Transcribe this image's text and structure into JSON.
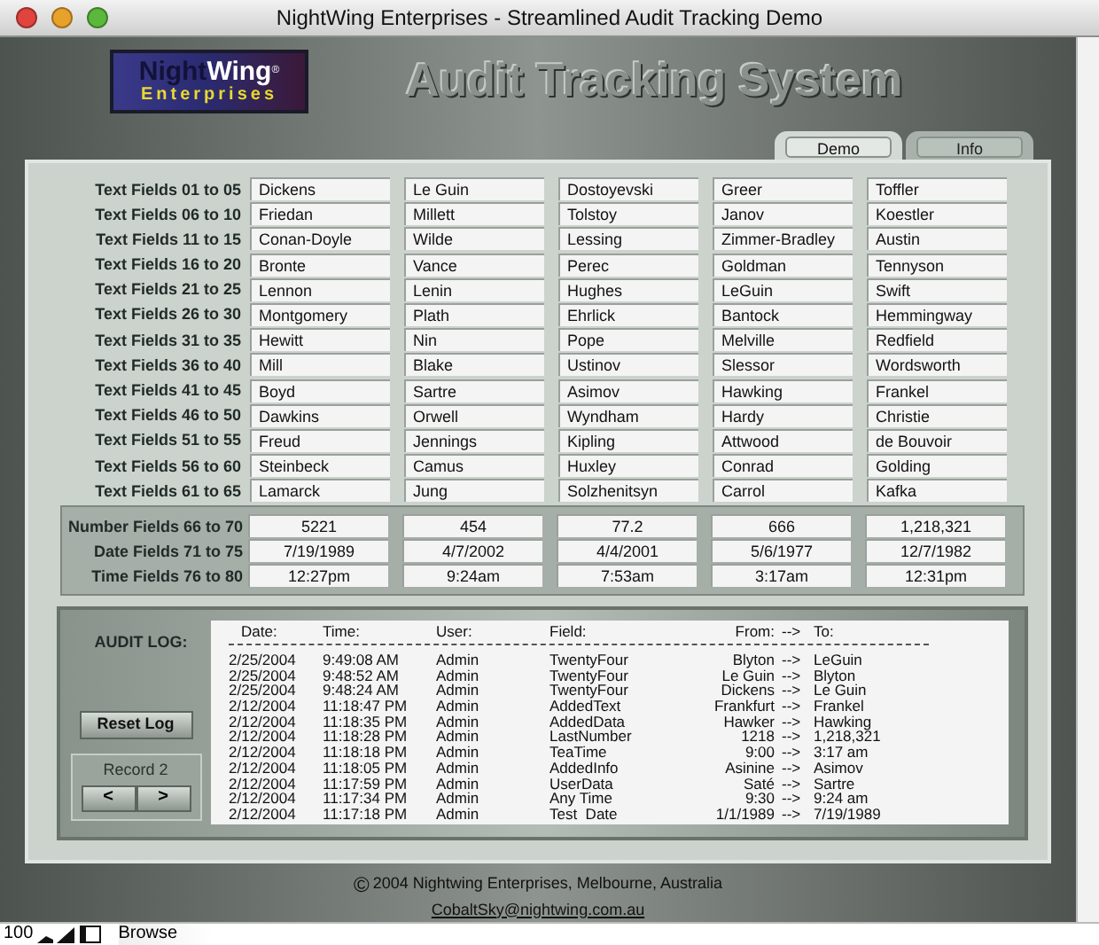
{
  "window": {
    "title": "NightWing Enterprises - Streamlined Audit Tracking Demo"
  },
  "logo": {
    "part1": "Night",
    "part2": "Wing",
    "mark": "®",
    "tagline": "Enterprises"
  },
  "heading": "Audit Tracking System",
  "tabs": [
    {
      "label": "Demo",
      "selected": true
    },
    {
      "label": "Info",
      "selected": false
    }
  ],
  "text_fields": [
    {
      "label": "Text Fields 01 to 05",
      "values": [
        "Dickens",
        "Le Guin",
        "Dostoyevski",
        "Greer",
        "Toffler"
      ]
    },
    {
      "label": "Text Fields 06 to 10",
      "values": [
        "Friedan",
        "Millett",
        "Tolstoy",
        "Janov",
        "Koestler"
      ]
    },
    {
      "label": "Text Fields 11 to 15",
      "values": [
        "Conan-Doyle",
        "Wilde",
        "Lessing",
        "Zimmer-Bradley",
        "Austin"
      ]
    },
    {
      "label": "Text Fields 16 to 20",
      "values": [
        "Bronte",
        "Vance",
        "Perec",
        "Goldman",
        "Tennyson"
      ]
    },
    {
      "label": "Text Fields 21 to 25",
      "values": [
        "Lennon",
        "Lenin",
        "Hughes",
        "LeGuin",
        "Swift"
      ]
    },
    {
      "label": "Text Fields 26 to 30",
      "values": [
        "Montgomery",
        "Plath",
        "Ehrlick",
        "Bantock",
        "Hemmingway"
      ]
    },
    {
      "label": "Text Fields 31 to 35",
      "values": [
        "Hewitt",
        "Nin",
        "Pope",
        "Melville",
        "Redfield"
      ]
    },
    {
      "label": "Text Fields 36 to 40",
      "values": [
        "Mill",
        "Blake",
        "Ustinov",
        "Slessor",
        "Wordsworth"
      ]
    },
    {
      "label": "Text Fields 41 to 45",
      "values": [
        "Boyd",
        "Sartre",
        "Asimov",
        "Hawking",
        "Frankel"
      ]
    },
    {
      "label": "Text Fields 46 to 50",
      "values": [
        "Dawkins",
        "Orwell",
        "Wyndham",
        "Hardy",
        "Christie"
      ]
    },
    {
      "label": "Text Fields 51 to 55",
      "values": [
        "Freud",
        "Jennings",
        "Kipling",
        "Attwood",
        "de Bouvoir"
      ]
    },
    {
      "label": "Text Fields 56 to 60",
      "values": [
        "Steinbeck",
        "Camus",
        "Huxley",
        "Conrad",
        "Golding"
      ]
    },
    {
      "label": "Text Fields 61 to 65",
      "values": [
        "Lamarck",
        "Jung",
        "Solzhenitsyn",
        "Carrol",
        "Kafka"
      ]
    }
  ],
  "typed_fields": [
    {
      "label": "Number Fields 66 to 70",
      "values": [
        "5221",
        "454",
        "77.2",
        "666",
        "1,218,321"
      ]
    },
    {
      "label": "Date Fields 71 to 75",
      "values": [
        "7/19/1989",
        "4/7/2002",
        "4/4/2001",
        "5/6/1977",
        "12/7/1982"
      ]
    },
    {
      "label": "Time Fields 76 to 80",
      "values": [
        "12:27pm",
        "9:24am",
        "7:53am",
        "3:17am",
        "12:31pm"
      ]
    }
  ],
  "audit_log": {
    "title": "AUDIT LOG:",
    "columns": [
      "Date:",
      "Time:",
      "User:",
      "Field:",
      "From:",
      "-->",
      "To:"
    ],
    "rows": [
      [
        "2/25/2004",
        "9:49:08 AM",
        "Admin",
        "TwentyFour",
        "Blyton",
        "-->",
        "LeGuin"
      ],
      [
        "2/25/2004",
        "9:48:52 AM",
        "Admin",
        "TwentyFour",
        "Le Guin",
        "-->",
        "Blyton"
      ],
      [
        "2/25/2004",
        "9:48:24 AM",
        "Admin",
        "TwentyFour",
        "Dickens",
        "-->",
        "Le Guin"
      ],
      [
        "2/12/2004",
        "11:18:47 PM",
        "Admin",
        "AddedText",
        "Frankfurt",
        "-->",
        "Frankel"
      ],
      [
        "2/12/2004",
        "11:18:35 PM",
        "Admin",
        "AddedData",
        "Hawker",
        "-->",
        "Hawking"
      ],
      [
        "2/12/2004",
        "11:18:28 PM",
        "Admin",
        "LastNumber",
        "1218",
        "-->",
        "1,218,321"
      ],
      [
        "2/12/2004",
        "11:18:18 PM",
        "Admin",
        "TeaTime",
        "9:00",
        "-->",
        "3:17 am"
      ],
      [
        "2/12/2004",
        "11:18:05 PM",
        "Admin",
        "AddedInfo",
        "Asinine",
        "-->",
        "Asimov"
      ],
      [
        "2/12/2004",
        "11:17:59 PM",
        "Admin",
        "UserData",
        "Saté",
        "-->",
        "Sartre"
      ],
      [
        "2/12/2004",
        "11:17:34 PM",
        "Admin",
        "Any Time",
        "9:30",
        "-->",
        "9:24 am"
      ],
      [
        "2/12/2004",
        "11:17:18 PM",
        "Admin",
        "Test  Date",
        "1/1/1989",
        "-->",
        "7/19/1989"
      ]
    ]
  },
  "reset_button": "Reset Log",
  "record": {
    "label": "Record 2",
    "prev": "<",
    "next": ">"
  },
  "footer": {
    "symbol": "©",
    "copyright": "2004 Nightwing Enterprises, Melbourne, Australia",
    "email": "CobaltSky@nightwing.com.au"
  },
  "status_bar": {
    "zoom": "100",
    "mode": "Browse"
  }
}
